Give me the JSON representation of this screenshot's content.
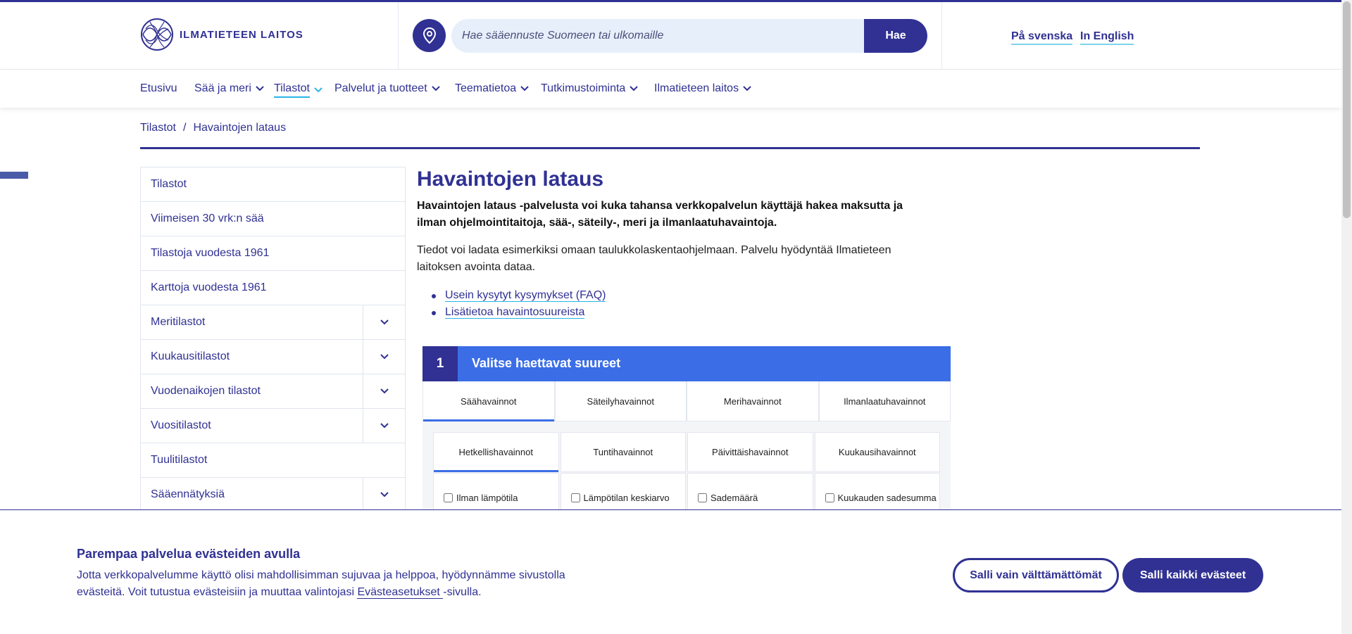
{
  "header": {
    "logo_text": "ILMATIETEEN LAITOS",
    "search_placeholder": "Hae sääennuste Suomeen tai ulkomaille",
    "search_button": "Hae",
    "lang_sv": "På svenska",
    "lang_en": "In English"
  },
  "nav": {
    "items": [
      {
        "label": "Etusivu"
      },
      {
        "label": "Sää ja meri"
      },
      {
        "label": "Tilastot"
      },
      {
        "label": "Palvelut ja tuotteet"
      },
      {
        "label": "Teematietoa"
      },
      {
        "label": "Tutkimustoiminta"
      },
      {
        "label": "Ilmatieteen laitos"
      }
    ]
  },
  "breadcrumb": {
    "items": [
      "Tilastot",
      "/",
      "Havaintojen lataus"
    ]
  },
  "sidebar": {
    "items": [
      {
        "label": "Tilastot"
      },
      {
        "label": "Viimeisen 30 vrk:n sää"
      },
      {
        "label": "Tilastoja vuodesta 1961"
      },
      {
        "label": "Karttoja vuodesta 1961"
      },
      {
        "label": "Meritilastot"
      },
      {
        "label": "Kuukausitilastot"
      },
      {
        "label": "Vuodenaikojen tilastot"
      },
      {
        "label": "Vuositilastot"
      },
      {
        "label": "Tuulitilastot"
      },
      {
        "label": "Sääennätyksiä"
      }
    ]
  },
  "main": {
    "title": "Havaintojen lataus",
    "lead": "Havaintojen lataus -palvelusta voi kuka tahansa verkkopalvelun käyttäjä hakea maksutta ja ilman ohjelmointitaitoja, sää-, säteily-, meri ja ilmanlaatuhavaintoja.",
    "body": "Tiedot voi ladata esimerkiksi omaan taulukkolaskentaohjelmaan. Palvelu hyödyntää Ilmatieteen laitoksen avointa dataa.",
    "links": [
      {
        "label": "Usein kysytyt kysymykset (FAQ)"
      },
      {
        "label": "Lisätietoa havaintosuureista"
      }
    ]
  },
  "step": {
    "number": "1",
    "title": "Valitse haettavat suureet"
  },
  "tabs_type": [
    {
      "label": "Säähavainnot"
    },
    {
      "label": "Säteilyhavainnot"
    },
    {
      "label": "Merihavainnot"
    },
    {
      "label": "Ilmanlaatuhavainnot"
    }
  ],
  "tabs_interval": [
    {
      "label": "Hetkellishavainnot"
    },
    {
      "label": "Tuntihavainnot"
    },
    {
      "label": "Päivittäishavainnot"
    },
    {
      "label": "Kuukausihavainnot"
    }
  ],
  "checkboxes": [
    {
      "label": "Ilman lämpötila"
    },
    {
      "label": "Lämpötilan keskiarvo"
    },
    {
      "label": "Sademäärä"
    },
    {
      "label": "Kuukauden sadesumma"
    }
  ],
  "cookie": {
    "title": "Parempaa palvelua evästeiden avulla",
    "text_before": "Jotta verkkopalvelumme käyttö olisi mahdollisimman sujuvaa ja helppoa, hyödynnämme sivustolla evästeitä. Voit tutustua evästeisiin ja muuttaa valintojasi ",
    "link": "Evästeasetukset ",
    "text_after": "-sivulla.",
    "btn_necessary": "Salli vain välttämättömät",
    "btn_all": "Salli kaikki evästeet"
  },
  "colors": {
    "brand": "#303193",
    "accent_blue": "#3b6ee6",
    "link_underline": "#29b5e8",
    "search_bg": "#e7effa"
  }
}
